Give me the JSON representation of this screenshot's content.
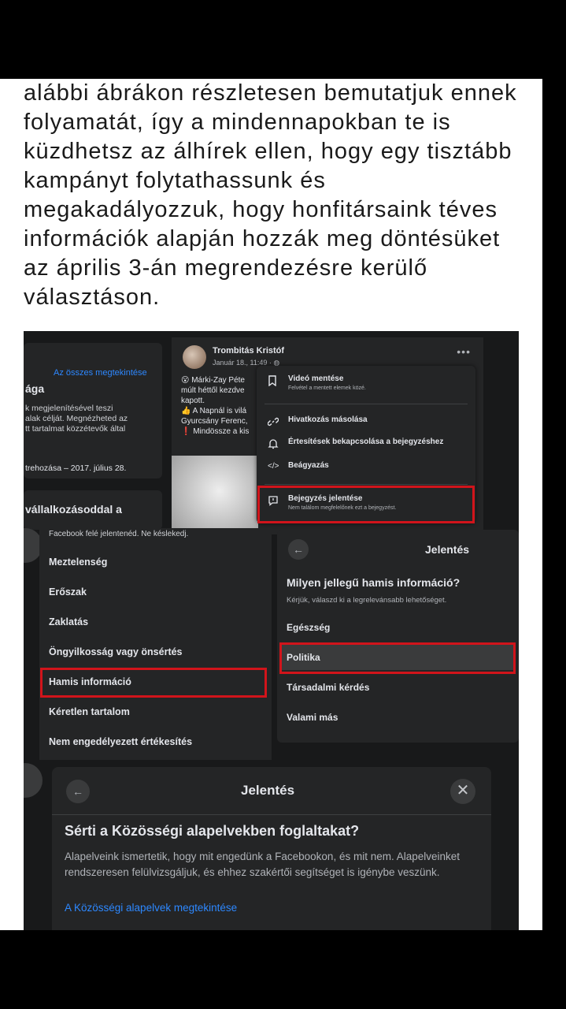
{
  "article": {
    "lines": [
      "alábbi ábrákon részletesen bemutatjuk ennek",
      "folyamatát, így a mindennapokban te is",
      "küzdhetsz az álhírek ellen, hogy egy tisztább",
      "kampányt folytathassunk és",
      "megakadályozzuk, hogy honfitársaink téves",
      "információk alapján hozzák meg döntésüket",
      "az április 3-án megrendezésre kerülő",
      "választáson."
    ]
  },
  "screenshot": {
    "left_card": {
      "link": "Az összes megtekintése",
      "title": "ága",
      "desc": "k megjelenítésével teszi\nalak célját. Megnézheted az\ntt tartalmat közzétevők által",
      "date": "trehozása – 2017. július 28.",
      "section": "vállalkozásoddal a"
    },
    "post": {
      "author": "Trombitás Kristóf",
      "date": "Január 18., 11:49 · ◍",
      "dots": "•••",
      "body": "😮 Márki-Zay Pétе\nmúlt héttől kezdve\nkapott.\n👍 A Napnál is vilá\nGyurcsány Ferenc,\n❗ Mindössze a kis"
    },
    "menu": {
      "items": [
        {
          "icon": "bookmark-icon",
          "glyph": "⌑",
          "title": "Videó mentése",
          "sub": "Felvétel a mentett elemek közé."
        },
        {
          "icon": "link-icon",
          "glyph": "🔗",
          "title": "Hivatkozás másolása",
          "sub": ""
        },
        {
          "icon": "bell-icon",
          "glyph": "🔔",
          "title": "Értesítések bekapcsolása a bejegyzéshez",
          "sub": ""
        },
        {
          "icon": "embed-icon",
          "glyph": "</>",
          "title": "Beágyazás",
          "sub": ""
        },
        {
          "icon": "report-icon",
          "glyph": "⚑",
          "title": "Bejegyzés jelentése",
          "sub": "Nem találom megfelelőnek ezt a bejegyzést."
        }
      ]
    },
    "report_list": {
      "top_text": "Facebook felé jelentenéd. Ne késlekedj.",
      "items": [
        "Meztelenség",
        "Erőszak",
        "Zaklatás",
        "Öngyilkosság vagy önsértés",
        "Hamis információ",
        "Kéretlen tartalom",
        "Nem engedélyezett értékesítés"
      ]
    },
    "report_panel": {
      "back": "←",
      "title": "Jelentés",
      "question": "Milyen jellegű hamis információ?",
      "subtitle": "Kérjük, válaszd ki a legrelevánsabb lehetőséget.",
      "options": [
        "Egészség",
        "Politika",
        "Társadalmi kérdés",
        "Valami más"
      ]
    },
    "bottom_dialog": {
      "back": "←",
      "title": "Jelentés",
      "close": "✕",
      "question": "Sérti a Közösségi alapelvekben foglaltakat?",
      "paragraph": "Alapelveink ismertetik, hogy mit engedünk a Facebookon, és mit nem. Alapelveinket rendszeresen felülvizsgáljuk, és ehhez szakértői segítséget is igénybe veszünk.",
      "link": "A Közösségi alapelvek megtekintése"
    },
    "colors": {
      "highlight_red": "#d1141b",
      "link_blue": "#2d88ff",
      "panel_bg": "#242526",
      "page_bg": "#18191a"
    }
  }
}
